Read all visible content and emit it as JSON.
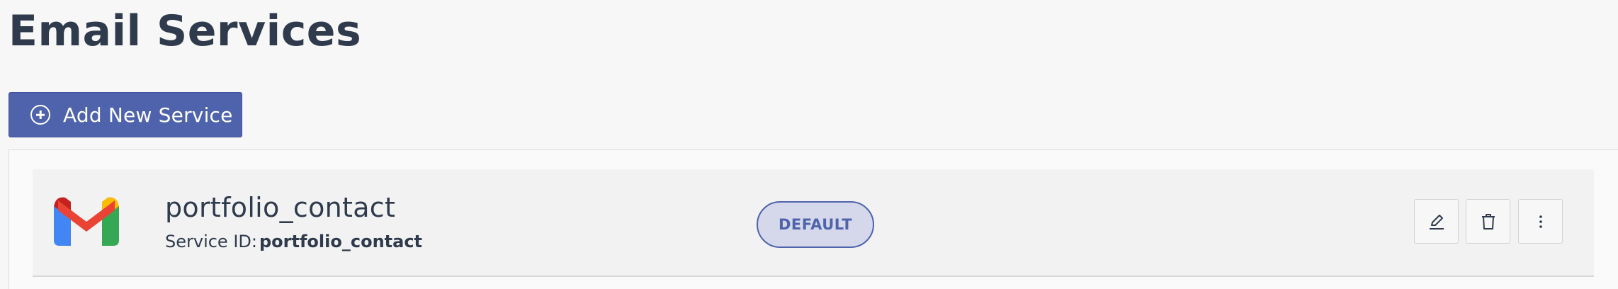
{
  "page": {
    "title": "Email Services"
  },
  "toolbar": {
    "add_button_label": "Add New Service",
    "add_button_icon": "plus-circle-icon"
  },
  "services": [
    {
      "provider_icon": "gmail-icon",
      "name": "portfolio_contact",
      "service_id_label": "Service ID:",
      "service_id": "portfolio_contact",
      "badge": "DEFAULT",
      "actions": {
        "edit_icon": "pencil-icon",
        "delete_icon": "trash-icon",
        "more_icon": "vertical-dots-icon"
      }
    }
  ],
  "colors": {
    "accent": "#4f63ad",
    "badge_bg": "#d4d8ea",
    "title_text": "#2f3b4c",
    "background": "#f7f7f7"
  }
}
